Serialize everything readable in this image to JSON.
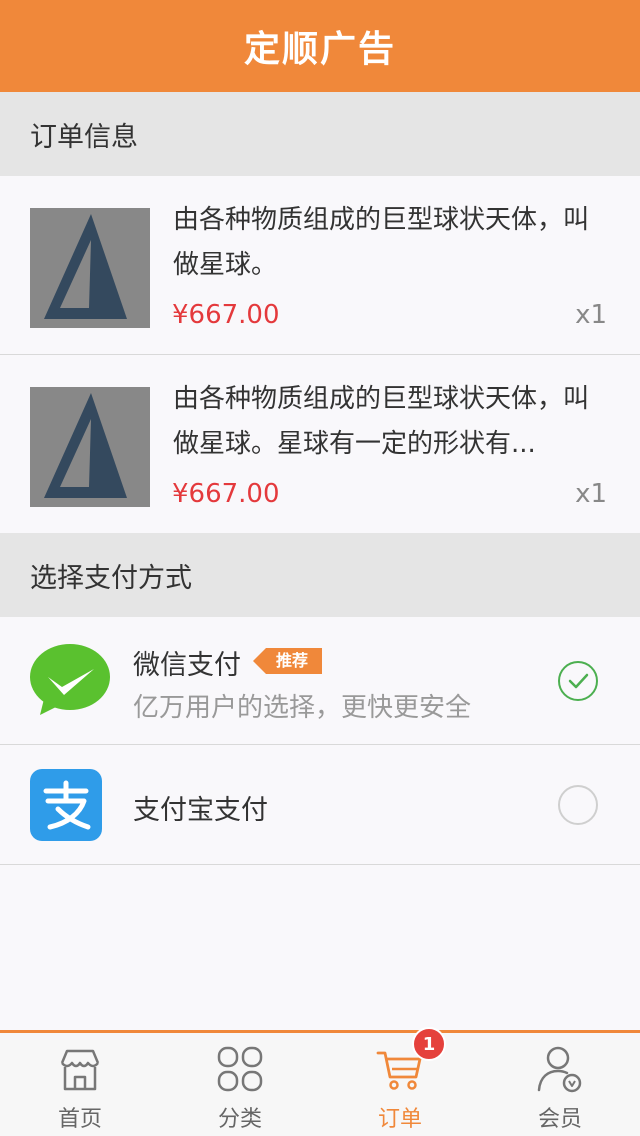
{
  "header": {
    "title": "定顺广告"
  },
  "order_section": {
    "title": "订单信息",
    "items": [
      {
        "description": "由各种物质组成的巨型球状天体，叫做星球。",
        "price": "¥667.00",
        "quantity": "x1"
      },
      {
        "description": "由各种物质组成的巨型球状天体，叫做星球。星球有一定的形状有...",
        "price": "¥667.00",
        "quantity": "x1"
      }
    ]
  },
  "payment_section": {
    "title": "选择支付方式",
    "options": [
      {
        "name": "微信支付",
        "tag": "推荐",
        "subtitle": "亿万用户的选择，更快更安全",
        "selected": true,
        "icon": "wechat-pay-icon"
      },
      {
        "name": "支付宝支付",
        "selected": false,
        "icon": "alipay-icon"
      }
    ]
  },
  "tabbar": {
    "tabs": [
      {
        "label": "首页",
        "icon": "storefront-icon",
        "active": false
      },
      {
        "label": "分类",
        "icon": "category-grid-icon",
        "active": false
      },
      {
        "label": "订单",
        "icon": "cart-icon",
        "active": true,
        "badge": "1"
      },
      {
        "label": "会员",
        "icon": "member-icon",
        "active": false
      }
    ]
  },
  "colors": {
    "accent": "#f0883a",
    "price": "#e4393c",
    "wechat_green": "#4caf50",
    "alipay_blue": "#2f9ce9",
    "badge": "#e5413c"
  }
}
